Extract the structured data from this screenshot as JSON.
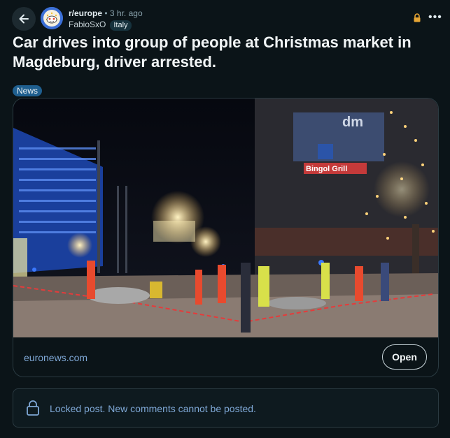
{
  "header": {
    "subreddit": "r/europe",
    "separator": "•",
    "time_ago": "3 hr. ago",
    "username": "FabioSxO",
    "user_flair": "Italy"
  },
  "post": {
    "title": "Car drives into group of people at Christmas market in Magdeburg, driver arrested.",
    "flair": "News",
    "link_domain": "euronews.com",
    "open_label": "Open",
    "sign_text": "Bingol Grill",
    "dm_text": "dm"
  },
  "locked": {
    "message": "Locked post. New comments cannot be posted."
  },
  "colors": {
    "background": "#0b1418",
    "accent_link": "#7fa8d6",
    "flair_bg": "#1f5f8f",
    "lock_orange": "#e6a534"
  },
  "icons": [
    "arrow-left-icon",
    "subreddit-avatar-icon",
    "lock-icon",
    "more-icon",
    "lock-outline-icon"
  ]
}
